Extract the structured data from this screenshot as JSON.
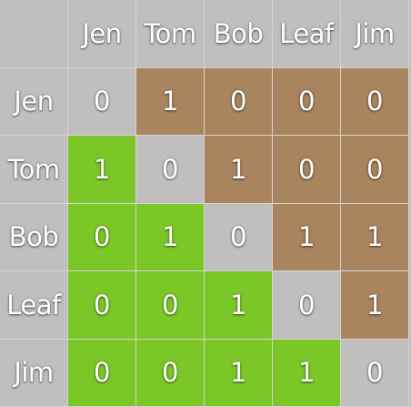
{
  "chart_data": {
    "type": "table",
    "title": "",
    "rows": [
      "Jen",
      "Tom",
      "Bob",
      "Leaf",
      "Jim"
    ],
    "columns": [
      "Jen",
      "Tom",
      "Bob",
      "Leaf",
      "Jim"
    ],
    "values": [
      [
        0,
        1,
        0,
        0,
        0
      ],
      [
        1,
        0,
        1,
        0,
        0
      ],
      [
        0,
        1,
        0,
        1,
        1
      ],
      [
        0,
        0,
        1,
        0,
        1
      ],
      [
        0,
        0,
        1,
        1,
        0
      ]
    ],
    "colors": {
      "header": "#c1bfbd",
      "diagonal": "#c1bfbd",
      "upper_triangle": "#a8855e",
      "lower_triangle": "#7ac727",
      "text": "#ffffff"
    }
  }
}
